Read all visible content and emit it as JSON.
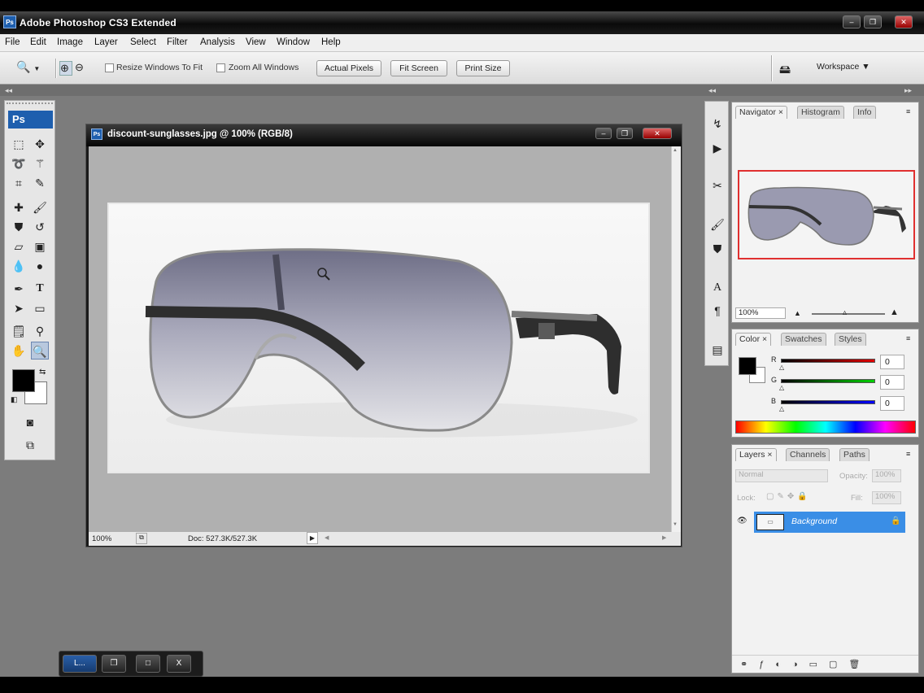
{
  "app": {
    "logo_text": "Ps",
    "title": "Adobe Photoshop CS3 Extended",
    "window_controls": [
      "–",
      "❐",
      "✕"
    ]
  },
  "menu": [
    "File",
    "Edit",
    "Image",
    "Layer",
    "Select",
    "Filter",
    "Analysis",
    "View",
    "Window",
    "Help"
  ],
  "options_bar": {
    "resize_windows_label": "Resize Windows To Fit",
    "zoom_all_label": "Zoom All Windows",
    "actual_pixels": "Actual Pixels",
    "fit_screen": "Fit Screen",
    "print_size": "Print Size",
    "workspace": "Workspace ▼"
  },
  "toolbox": {
    "logo": "Ps",
    "tools": [
      "marquee-icon",
      "move-icon",
      "lasso-icon",
      "magic-wand-icon",
      "crop-icon",
      "slice-icon",
      "healing-brush-icon",
      "brush-icon",
      "clone-stamp-icon",
      "history-brush-icon",
      "eraser-icon",
      "gradient-icon",
      "blur-icon",
      "dodge-icon",
      "pen-icon",
      "type-icon",
      "path-selection-icon",
      "rectangle-icon",
      "notes-icon",
      "eyedropper-icon",
      "hand-icon",
      "zoom-icon"
    ]
  },
  "document": {
    "title": "discount-sunglasses.jpg @ 100% (RGB/8)",
    "zoom": "100%",
    "doc_size": "Doc: 527.3K/527.3K"
  },
  "navigator": {
    "tabs": [
      "Navigator",
      "Histogram",
      "Info"
    ],
    "zoom": "100%"
  },
  "color_panel": {
    "tabs": [
      "Color",
      "Swatches",
      "Styles"
    ],
    "channels": [
      {
        "label": "R",
        "value": "0",
        "color": "#d40000"
      },
      {
        "label": "G",
        "value": "0",
        "color": "#00b400"
      },
      {
        "label": "B",
        "value": "0",
        "color": "#0000d0"
      }
    ]
  },
  "layers_panel": {
    "tabs": [
      "Layers",
      "Channels",
      "Paths"
    ],
    "blend_mode": "Normal",
    "opacity_label": "Opacity:",
    "opacity": "100%",
    "lock_label": "Lock:",
    "fill_label": "Fill:",
    "fill": "100%",
    "layers": [
      {
        "name": "Background",
        "selected": true
      }
    ]
  },
  "taskbar": {
    "minimized_label": "L...",
    "buttons": [
      "❐",
      "□",
      "X"
    ]
  },
  "colors": {
    "accent": "#1e5fae",
    "selected_layer": "#3a8ee6",
    "navigator_box": "#e03030"
  }
}
